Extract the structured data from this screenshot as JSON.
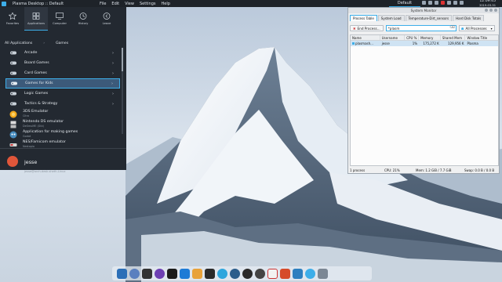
{
  "top_panel": {
    "window_title": "Plasma Desktop :: Default",
    "menu": [
      "File",
      "Edit",
      "View",
      "Settings",
      "Help"
    ],
    "virtual_desktop": "Default",
    "clock_time": "12:09:45",
    "clock_date": "2019-03-31"
  },
  "launcher": {
    "tabs": [
      "Favorites",
      "Applications",
      "Computer",
      "History",
      "Leave"
    ],
    "active_tab": "Applications",
    "breadcrumb": [
      "All Applications",
      "Games"
    ],
    "items": [
      {
        "label": "Arcade"
      },
      {
        "label": "Board Games"
      },
      {
        "label": "Card Games"
      },
      {
        "label": "Games for Kids"
      },
      {
        "label": "Logic Games"
      },
      {
        "label": "Tactics & Strategy"
      }
    ],
    "apps": [
      {
        "label": "3DS Emulator",
        "sub": "Citra"
      },
      {
        "label": "Nintendo DS emulator",
        "sub": "DeSmuME (Gtk)"
      },
      {
        "label": "Application for making games",
        "sub": "Godot"
      },
      {
        "label": "NES/Famicom emulator",
        "sub": "Nestopia"
      }
    ],
    "user": {
      "name": "jesse",
      "host": "jesse@arch-desk.sheth-Linux"
    }
  },
  "sysmon": {
    "title": "System Monitor",
    "tabs": [
      "Process Table",
      "System Load",
      "Temperature-Dirt_sensors",
      "Hard Disk Totals"
    ],
    "end_process_label": "End Process...",
    "filter_value": "*plasm",
    "process_filter": "All Processes",
    "columns": [
      "Name",
      "Username",
      "CPU %",
      "Memory",
      "Shared Mem",
      "Window Title"
    ],
    "rows": [
      {
        "name": "plasmash...",
        "user": "jesse",
        "cpu": "1%",
        "mem": "175,272 K",
        "shared": "129,956 K",
        "title": "Plasma"
      }
    ],
    "status": {
      "processes": "1 process",
      "cpu": "CPU: 21%",
      "mem": "Mem: 1.2 GiB / 7.7 GiB",
      "swap": "Swap: 0.0 B / 0.0 B"
    }
  },
  "colors": {
    "accent": "#3daee9",
    "panel": "#1e2329",
    "launcher": "#232931",
    "selection": "#3c5a7a"
  },
  "dock": {
    "icons": [
      "files-icon",
      "browser-icon",
      "terminal-icon",
      "editor-icon",
      "music-icon",
      "settings-icon",
      "games-icon",
      "chat-icon",
      "telegram-icon",
      "steam-icon",
      "obs-icon",
      "media-icon",
      "calendar-icon",
      "store-icon",
      "monitor-icon",
      "power-icon",
      "trash-icon"
    ]
  }
}
